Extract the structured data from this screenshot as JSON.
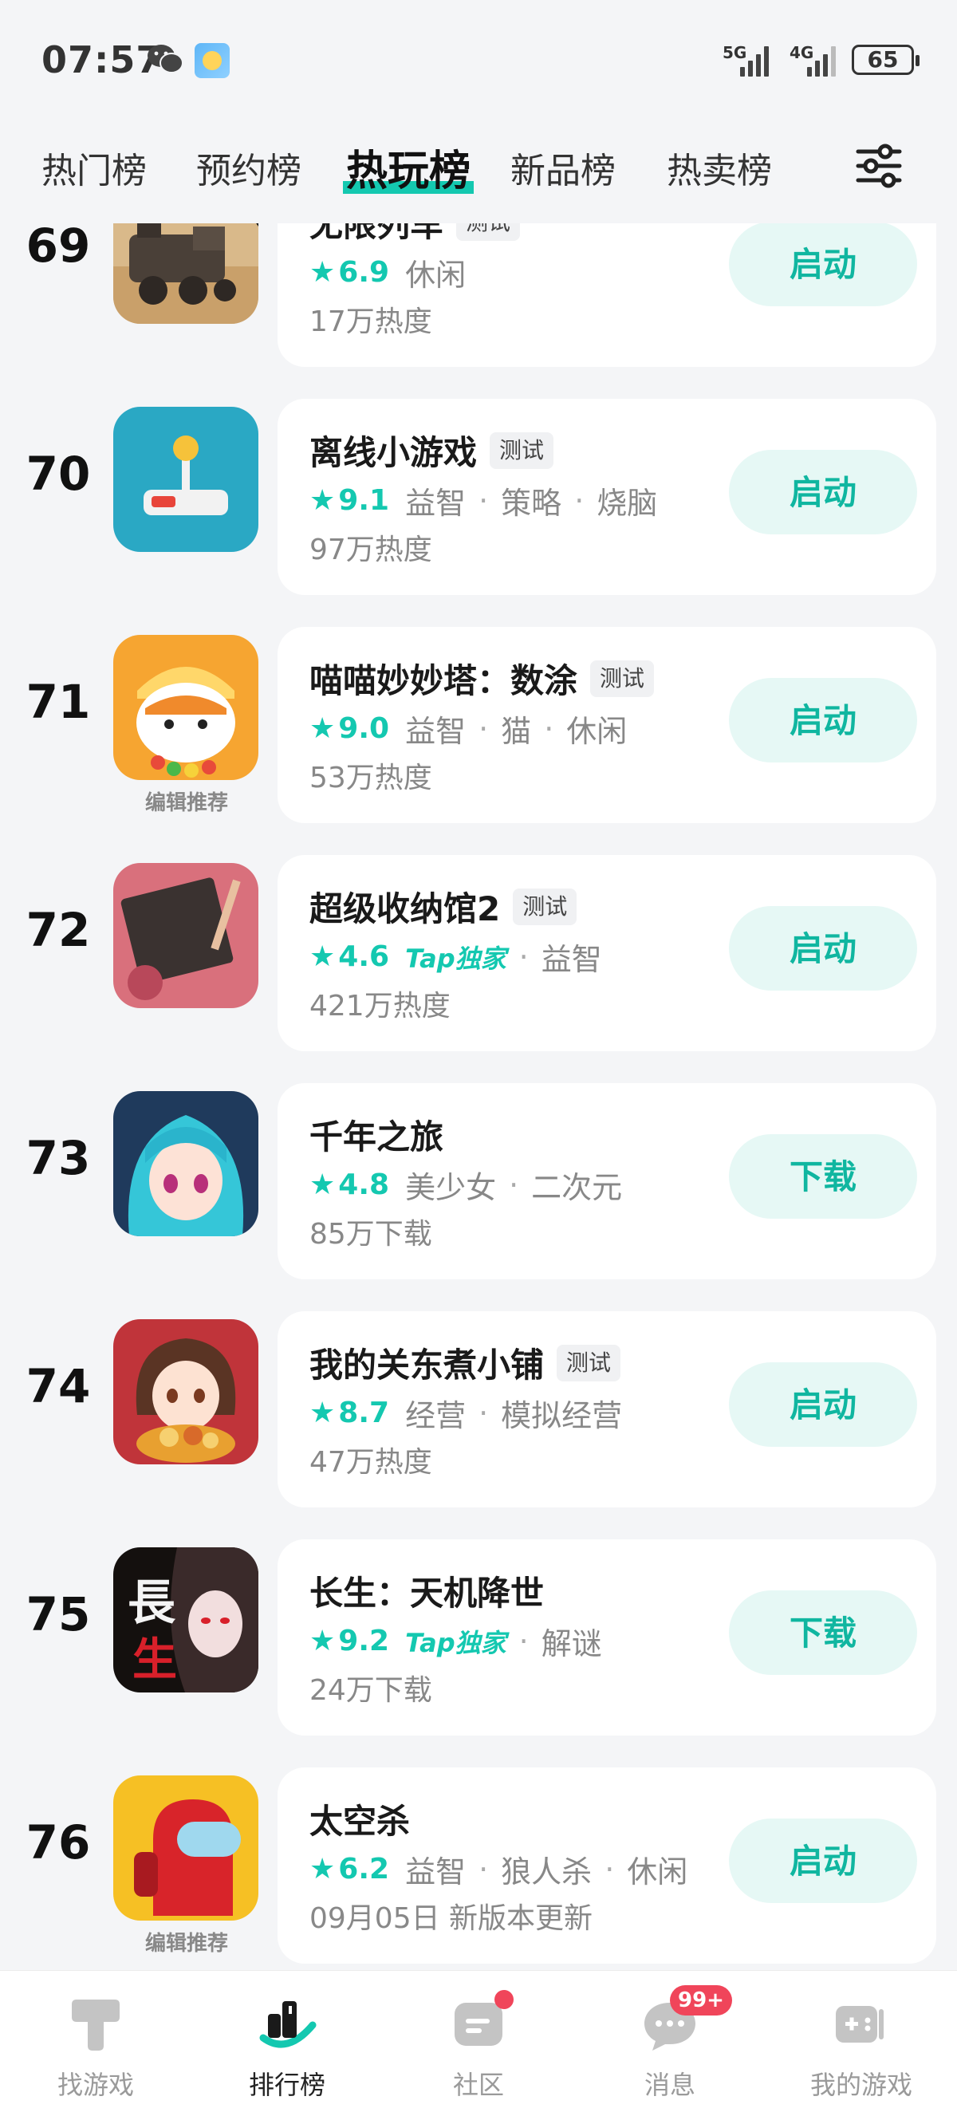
{
  "status_bar": {
    "time": "07:57",
    "network_1": "5G",
    "network_2": "4G",
    "battery": "65"
  },
  "tabs": [
    {
      "label": "热门榜",
      "active": false
    },
    {
      "label": "预约榜",
      "active": false
    },
    {
      "label": "热玩榜",
      "active": true
    },
    {
      "label": "新品榜",
      "active": false
    },
    {
      "label": "热卖榜",
      "active": false
    }
  ],
  "colors": {
    "accent": "#14c8b0",
    "button_bg": "#e6f8f5",
    "badge_red": "#f0455a"
  },
  "games": [
    {
      "rank": "69",
      "title": "无限列车",
      "tag": "测试",
      "score": "6.9",
      "tap_exclusive": "",
      "genres": [
        "休闲"
      ],
      "sub": "17万热度",
      "action": "启动",
      "editor_pick": ""
    },
    {
      "rank": "70",
      "title": "离线小游戏",
      "tag": "测试",
      "score": "9.1",
      "tap_exclusive": "",
      "genres": [
        "益智",
        "策略",
        "烧脑"
      ],
      "sub": "97万热度",
      "action": "启动",
      "editor_pick": ""
    },
    {
      "rank": "71",
      "title": "喵喵妙妙塔：数涂",
      "tag": "测试",
      "score": "9.0",
      "tap_exclusive": "",
      "genres": [
        "益智",
        "猫",
        "休闲"
      ],
      "sub": "53万热度",
      "action": "启动",
      "editor_pick": "编辑推荐"
    },
    {
      "rank": "72",
      "title": "超级收纳馆2",
      "tag": "测试",
      "score": "4.6",
      "tap_exclusive": "Tap独家",
      "genres": [
        "益智"
      ],
      "sub": "421万热度",
      "action": "启动",
      "editor_pick": ""
    },
    {
      "rank": "73",
      "title": "千年之旅",
      "tag": "",
      "score": "4.8",
      "tap_exclusive": "",
      "genres": [
        "美少女",
        "二次元"
      ],
      "sub": "85万下载",
      "action": "下载",
      "editor_pick": ""
    },
    {
      "rank": "74",
      "title": "我的关东煮小铺",
      "tag": "测试",
      "score": "8.7",
      "tap_exclusive": "",
      "genres": [
        "经营",
        "模拟经营"
      ],
      "sub": "47万热度",
      "action": "启动",
      "editor_pick": ""
    },
    {
      "rank": "75",
      "title": "长生：天机降世",
      "tag": "",
      "score": "9.2",
      "tap_exclusive": "Tap独家",
      "genres": [
        "解谜"
      ],
      "sub": "24万下载",
      "action": "下载",
      "editor_pick": ""
    },
    {
      "rank": "76",
      "title": "太空杀",
      "tag": "",
      "score": "6.2",
      "tap_exclusive": "",
      "genres": [
        "益智",
        "狼人杀",
        "休闲"
      ],
      "sub": "09月05日 新版本更新",
      "action": "启动",
      "editor_pick": "编辑推荐"
    }
  ],
  "bottom_nav": [
    {
      "label": "找游戏",
      "active": false,
      "icon": "find-games-icon"
    },
    {
      "label": "排行榜",
      "active": true,
      "icon": "leaderboard-icon"
    },
    {
      "label": "社区",
      "active": false,
      "icon": "community-icon"
    },
    {
      "label": "消息",
      "active": false,
      "icon": "message-icon",
      "badge": "99+"
    },
    {
      "label": "我的游戏",
      "active": false,
      "icon": "my-games-icon"
    }
  ]
}
